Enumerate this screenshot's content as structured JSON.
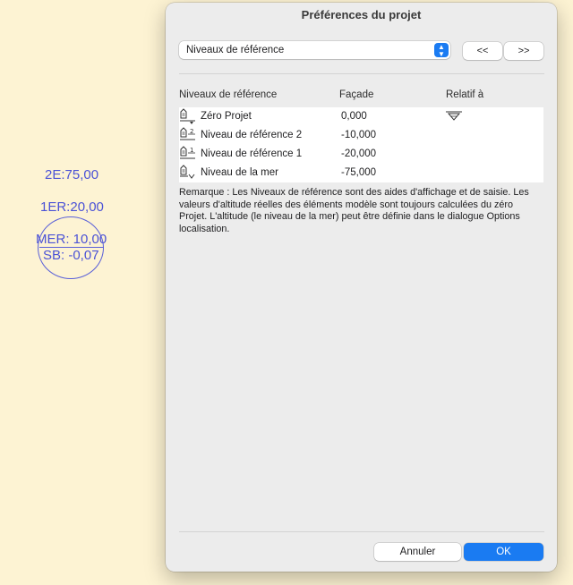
{
  "canvas": {
    "label_2e": "2E:75,00",
    "label_1er": "1ER:20,00",
    "label_mer": "MER: 10,00",
    "label_sb": "SB: -0,07"
  },
  "dialog": {
    "title": "Préférences du projet",
    "select_value": "Niveaux de référence",
    "prev_label": "<<",
    "next_label": ">>",
    "columns": [
      "Niveaux de référence",
      "Façade",
      "Relatif à"
    ],
    "rows": [
      {
        "name": "Zéro Projet",
        "value": "0,000",
        "icon": "project-zero-icon",
        "relative": true
      },
      {
        "name": "Niveau de référence 2",
        "value": "-10,000",
        "icon": "reference-level-2-icon",
        "relative": false
      },
      {
        "name": "Niveau de référence 1",
        "value": "-20,000",
        "icon": "reference-level-1-icon",
        "relative": false
      },
      {
        "name": "Niveau de la mer",
        "value": "-75,000",
        "icon": "sea-level-icon",
        "relative": false
      }
    ],
    "note": "Remarque : Les Niveaux de référence sont des aides d'affichage et de saisie. Les valeurs d'altitude réelles des éléments modèle sont toujours calculées du zéro Projet. L'altitude (le niveau de la mer) peut être définie dans le dialogue Options localisation.",
    "cancel_label": "Annuler",
    "ok_label": "OK"
  },
  "colors": {
    "background": "#fdf3d3",
    "canvas_annotation": "#4b52d6",
    "accent": "#1a7bf2"
  }
}
